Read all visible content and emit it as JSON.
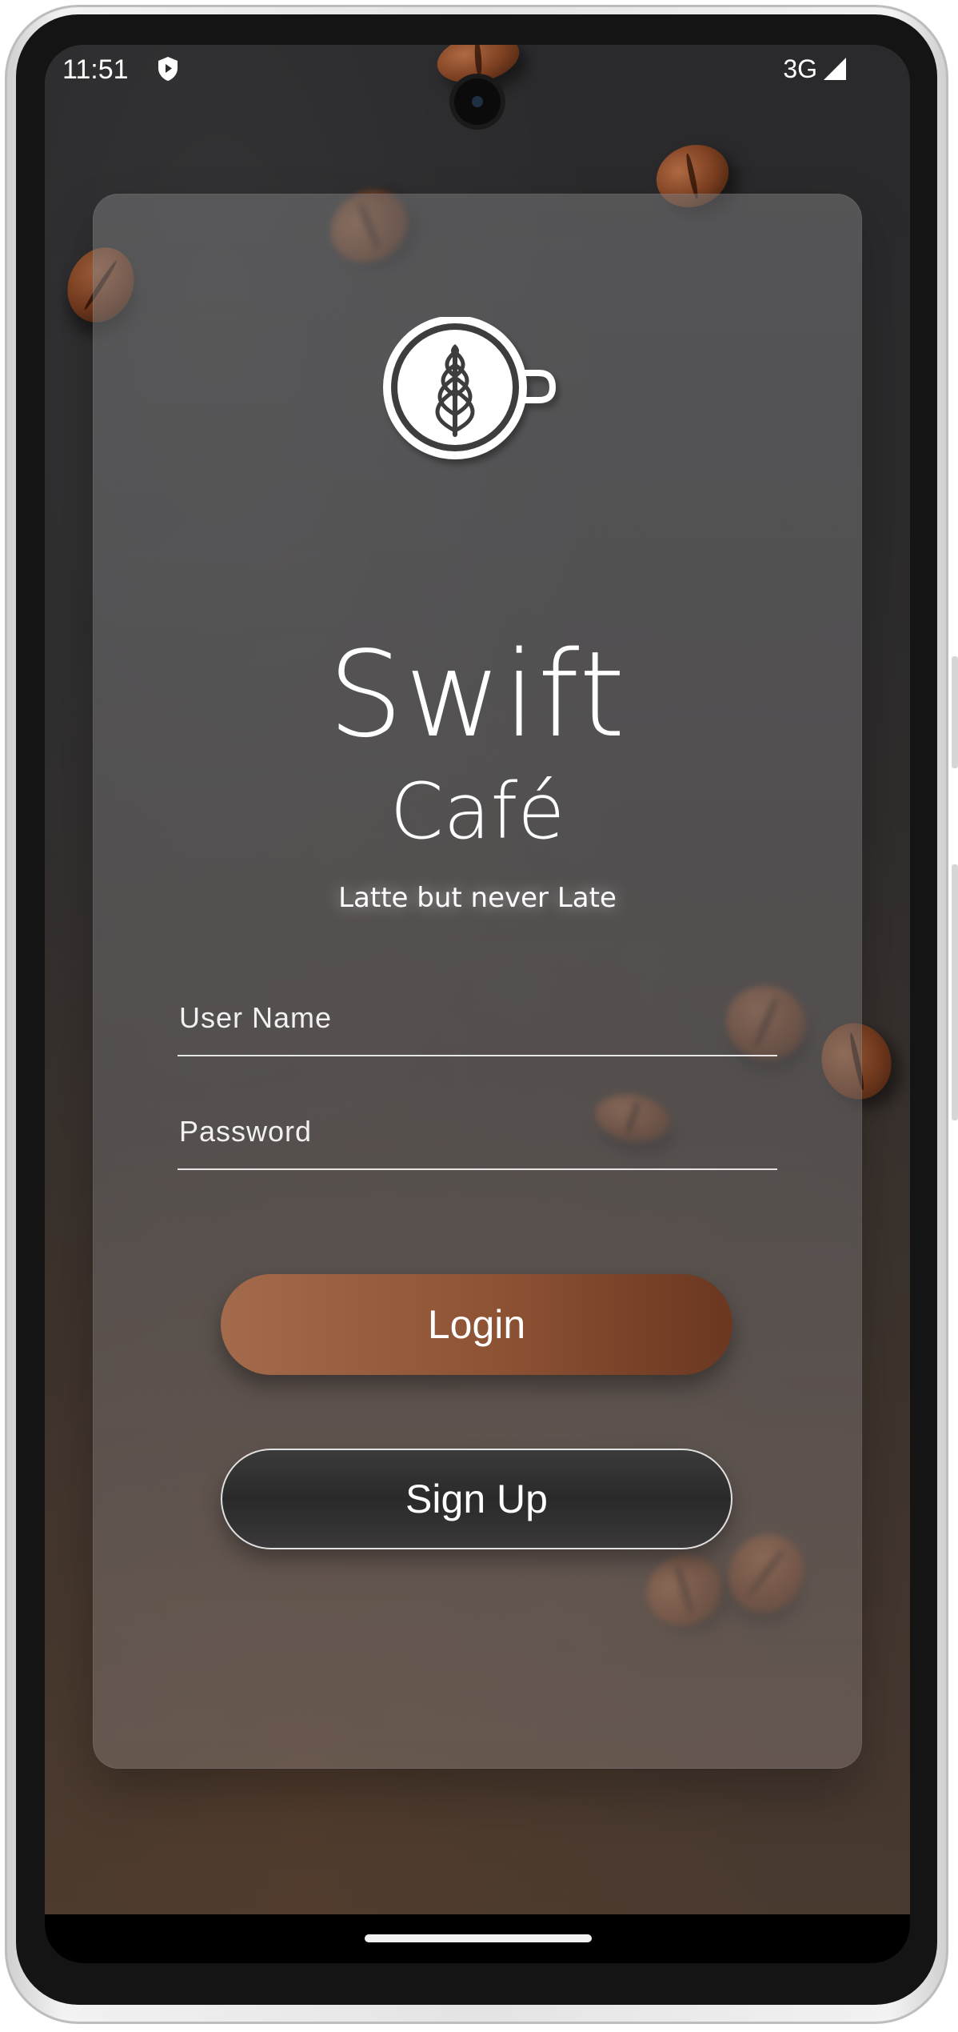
{
  "status_bar": {
    "time": "11:51",
    "network": "3G",
    "icons": [
      "shield-play-icon",
      "signal-icon"
    ]
  },
  "brand": {
    "logo_icon": "latte-art-cup-icon",
    "title": "Swift",
    "subtitle": "Café",
    "tagline": "Latte but never Late"
  },
  "form": {
    "username": {
      "value": "",
      "placeholder": "User Name"
    },
    "password": {
      "value": "",
      "placeholder": "Password"
    }
  },
  "buttons": {
    "login": "Login",
    "signup": "Sign Up"
  },
  "colors": {
    "accent": "#8d5234",
    "accent_light": "#a46a4c",
    "background": "#2b2a2c",
    "text": "#ffffff"
  }
}
